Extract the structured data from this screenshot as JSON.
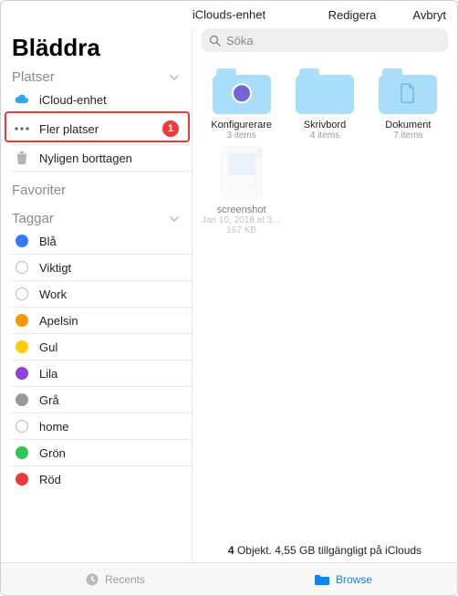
{
  "topbar": {
    "edit": "Redigera",
    "title": "iClouds-enhet",
    "cancel": "Avbryt"
  },
  "search": {
    "placeholder": "Söka"
  },
  "sidebar": {
    "title": "Bläddra",
    "sections": {
      "locations": {
        "label": "Platser"
      },
      "favorites": {
        "label": "Favoriter"
      },
      "tags": {
        "label": "Taggar"
      }
    },
    "locations": [
      {
        "label": "iCloud-enhet"
      },
      {
        "label": "Fler platser",
        "badge": "1"
      },
      {
        "label": "Nyligen borttagen"
      }
    ],
    "tags": [
      {
        "label": "Blå",
        "color": "#2f7dff"
      },
      {
        "label": "Viktigt",
        "color": "hollow"
      },
      {
        "label": "Work",
        "color": "hollow"
      },
      {
        "label": "Apelsin",
        "color": "#ff9500"
      },
      {
        "label": "Gul",
        "color": "#ffcc00"
      },
      {
        "label": "Lila",
        "color": "#8e44dc"
      },
      {
        "label": "Grå",
        "color": "#9a9a9e"
      },
      {
        "label": "home",
        "color": "hollow"
      },
      {
        "label": "Grön",
        "color": "#30c552"
      },
      {
        "label": "Röd",
        "color": "#ec3b3b"
      }
    ]
  },
  "grid": {
    "folders": [
      {
        "name": "Konfigurerare",
        "sub": "3 items",
        "overlay": "purple-circle"
      },
      {
        "name": "Skrivbord",
        "sub": "4 items",
        "overlay": "none"
      },
      {
        "name": "Dokument",
        "sub": "7 items",
        "overlay": "doc"
      }
    ],
    "file": {
      "name": "screenshot",
      "date": "Jan 10, 2018 at 3…",
      "size": "167 KB"
    }
  },
  "status": {
    "count": "4",
    "text": " Objekt. 4,55 GB tillgängligt på iClouds"
  },
  "bottom": {
    "recents": "Recents",
    "browse": "Browse"
  }
}
